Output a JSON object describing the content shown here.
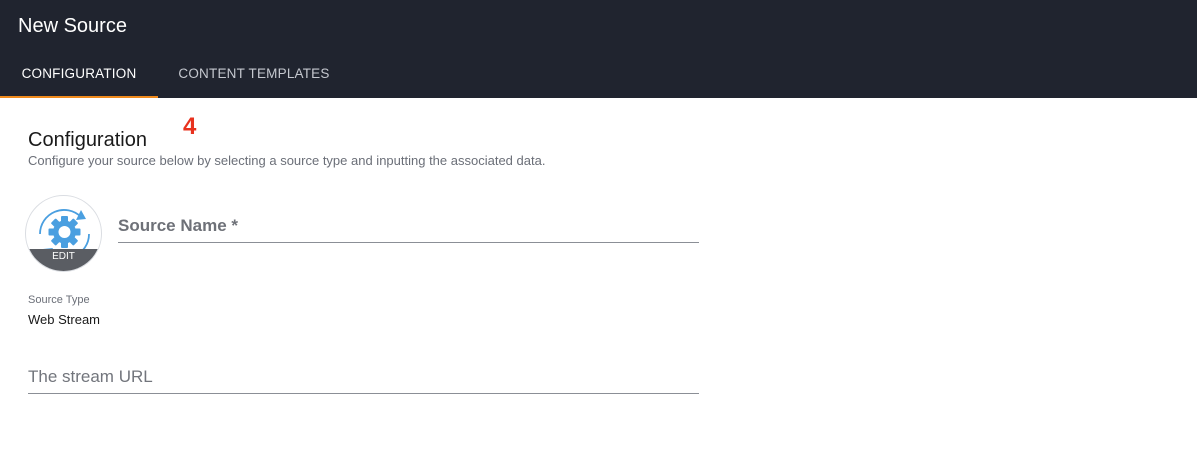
{
  "header": {
    "title": "New Source",
    "tabs": [
      {
        "label": "CONFIGURATION",
        "active": true
      },
      {
        "label": "CONTENT TEMPLATES",
        "active": false
      }
    ]
  },
  "marker": "4",
  "section": {
    "title": "Configuration",
    "subtitle": "Configure your source below by selecting a source type and inputting the associated data."
  },
  "avatar": {
    "icon": "gear-sync-icon",
    "edit_label": "EDIT"
  },
  "source_name": {
    "placeholder": "Source Name *",
    "value": ""
  },
  "source_type": {
    "label": "Source Type",
    "value": "Web Stream"
  },
  "stream_url": {
    "placeholder": "The stream URL",
    "value": ""
  },
  "colors": {
    "header_bg": "#20242f",
    "tab_indicator": "#f08a1c",
    "marker": "#e8321e",
    "icon_blue": "#4a9fe0"
  }
}
